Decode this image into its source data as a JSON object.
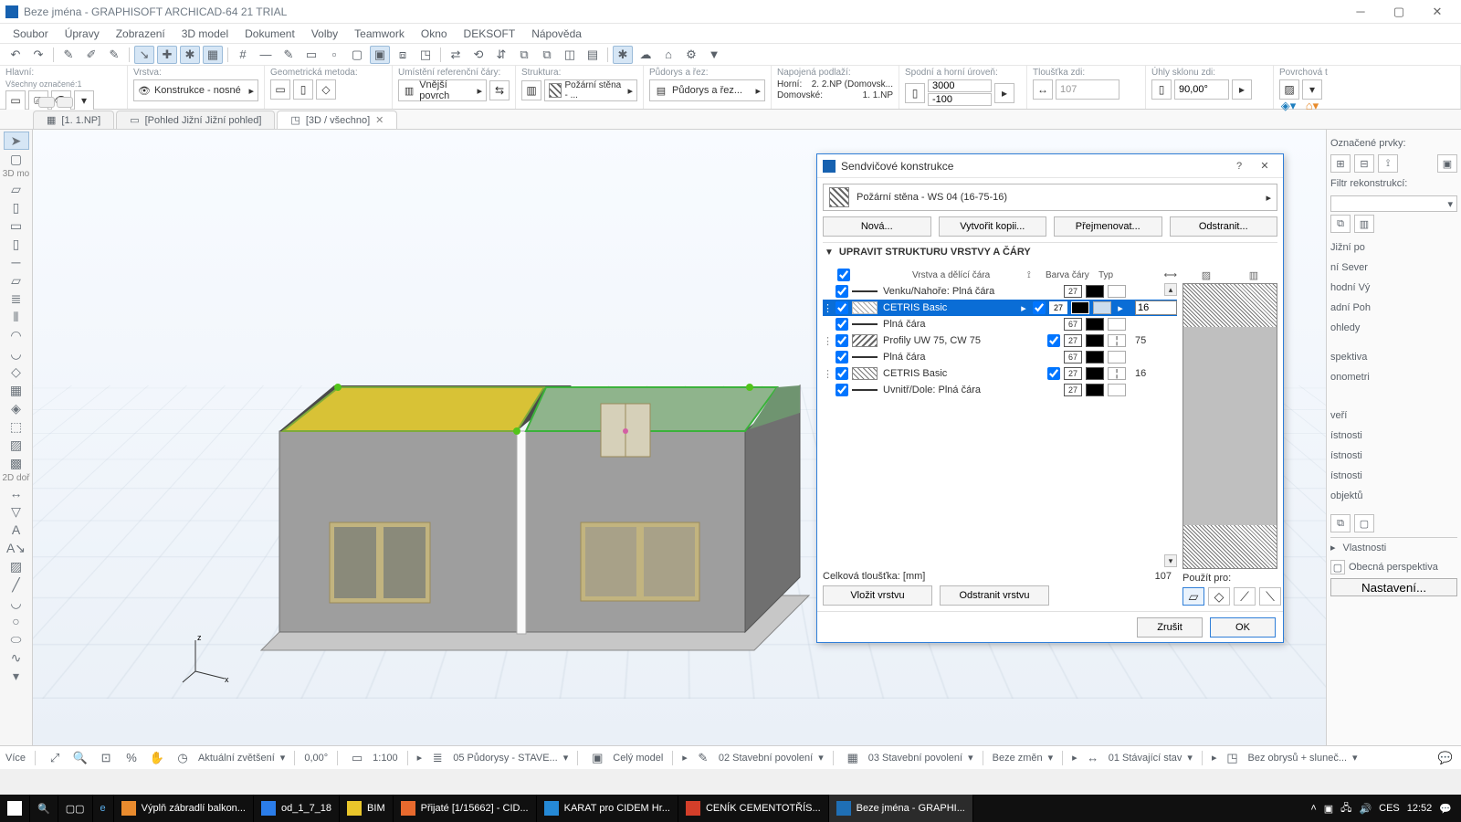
{
  "window": {
    "title": "Beze jména - GRAPHISOFT ARCHICAD-64 21 TRIAL"
  },
  "menubar": [
    "Soubor",
    "Úpravy",
    "Zobrazení",
    "3D model",
    "Dokument",
    "Volby",
    "Teamwork",
    "Okno",
    "DEKSOFT",
    "Nápověda"
  ],
  "optionsbar": {
    "group1": {
      "label": "Hlavní:",
      "sub": "Všechny označené:1"
    },
    "group2": {
      "label": "Vrstva:",
      "value": "Konstrukce - nosné"
    },
    "group3": {
      "label": "Geometrická metoda:"
    },
    "group4": {
      "label": "Umístění referenční čáry:",
      "value": "Vnější povrch"
    },
    "group5": {
      "label": "Struktura:",
      "value": "Požární stěna - ..."
    },
    "group6": {
      "label": "Půdorys a řez:",
      "value": "Půdorys a řez..."
    },
    "group7": {
      "label": "Napojená podlaží:",
      "rows": [
        [
          "Horní:",
          "2. 2.NP (Domovsk..."
        ],
        [
          "Domovské:",
          "1. 1.NP"
        ]
      ]
    },
    "group8": {
      "label": "Spodní a horní úroveň:",
      "top": "3000",
      "bottom": "-100"
    },
    "group9": {
      "label": "Tloušťka zdi:",
      "value": "107"
    },
    "group10": {
      "label": "Úhly sklonu zdi:",
      "value": "90,00°"
    },
    "group11": {
      "label": "Povrchová t"
    }
  },
  "tabs": [
    {
      "label": "[1. 1.NP]",
      "active": false,
      "closable": false
    },
    {
      "label": "[Pohled Jižní Jižní pohled]",
      "active": false,
      "closable": false
    },
    {
      "label": "[3D / všechno]",
      "active": true,
      "closable": true
    }
  ],
  "left_tools_labels": {
    "mo": "3D mo",
    "do": "2D doř"
  },
  "axis": {
    "x": "x",
    "z": "z"
  },
  "statusbar": {
    "vice": "Více",
    "zoom": "Aktuální zvětšení",
    "angle": "0,00°",
    "scale": "1:100",
    "items": [
      "05 Půdorysy - STAVE...",
      "Celý model",
      "02 Stavební povolení",
      "03 Stavební povolení",
      "Beze změn",
      "01 Stávající stav",
      "Bez obrysů + sluneč..."
    ]
  },
  "right_panel": {
    "marked": "Označené prvky:",
    "filter": "Filtr rekonstrukcí:",
    "lines": [
      "Jižní po",
      "ní Sever",
      "hodní Vý",
      "adní Poh",
      "ohledy",
      "spektiva",
      "onometri",
      "veří",
      "ístnosti",
      "ístnosti",
      "ístnosti",
      "objektů"
    ],
    "props": "Vlastnosti",
    "view": "Obecná perspektiva",
    "settings": "Nastavení..."
  },
  "dialog": {
    "title": "Sendvičové konstrukce",
    "selected": "Požární stěna - WS 04 (16-75-16)",
    "buttons": {
      "new": "Nová...",
      "copy": "Vytvořit kopii...",
      "rename": "Přejmenovat...",
      "delete": "Odstranit..."
    },
    "section": "UPRAVIT STRUKTURU VRSTVY A ČÁRY",
    "columns": {
      "name": "Vrstva a dělící čára",
      "color": "Barva čáry",
      "typ": "Typ"
    },
    "layers": [
      {
        "kind": "line",
        "name": "Venku/Nahoře: Plná čára",
        "c": "27"
      },
      {
        "kind": "layer",
        "name": "CETRIS Basic",
        "c": "27",
        "th": "16",
        "hatch": "cross",
        "selected": true
      },
      {
        "kind": "line",
        "name": "Plná čára",
        "c": "67"
      },
      {
        "kind": "layer",
        "name": "Profily UW 75, CW 75",
        "c": "27",
        "th": "75",
        "hatch": "diag2"
      },
      {
        "kind": "line",
        "name": "Plná čára",
        "c": "67"
      },
      {
        "kind": "layer",
        "name": "CETRIS Basic",
        "c": "27",
        "th": "16",
        "hatch": "cross"
      },
      {
        "kind": "line",
        "name": "Uvnitř/Dole: Plná čára",
        "c": "27"
      }
    ],
    "total_label": "Celková tloušťka: [mm]",
    "total_value": "107",
    "use_label": "Použít pro:",
    "layer_btns": {
      "insert": "Vložit vrstvu",
      "remove": "Odstranit vrstvu"
    },
    "footer": {
      "cancel": "Zrušit",
      "ok": "OK"
    }
  },
  "taskbar": {
    "items": [
      {
        "label": "Výplň zábradlí balkon...",
        "color": "#e98b2e"
      },
      {
        "label": "od_1_7_18",
        "color": "#2b7de9"
      },
      {
        "label": "BIM",
        "color": "#e9c62b"
      },
      {
        "label": "Přijaté [1/15662] - CID...",
        "color": "#e86a2e"
      },
      {
        "label": "KARAT pro CIDEM Hr...",
        "color": "#2589d6"
      },
      {
        "label": "CENÍK CEMENTOTŘÍS...",
        "color": "#d43f2a"
      },
      {
        "label": "Beze jména - GRAPHI...",
        "color": "#1f6fb5",
        "active": true
      }
    ],
    "lang": "CES",
    "time": "12:52"
  }
}
